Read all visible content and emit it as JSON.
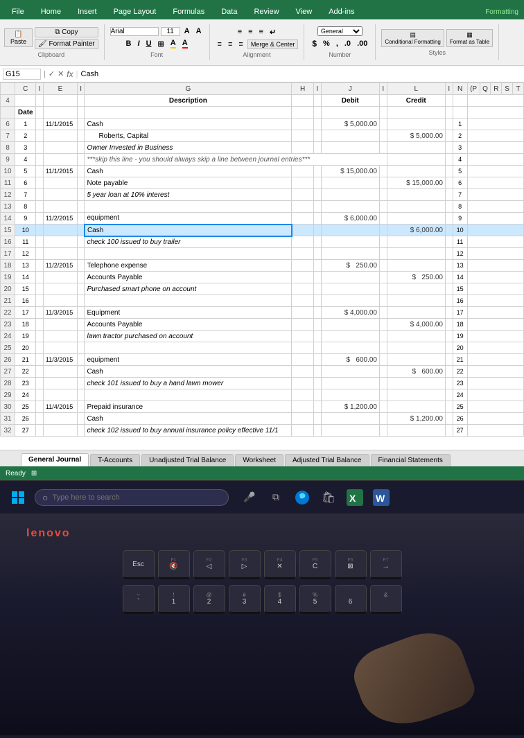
{
  "ribbon": {
    "tabs": [
      "File",
      "Home",
      "Insert",
      "Page Layout",
      "Formulas",
      "Data",
      "Review",
      "View",
      "Add-ins"
    ],
    "active_tab": "Home",
    "clipboard_group": "Clipboard",
    "paste_label": "Paste",
    "copy_label": "Copy",
    "format_painter_label": "Format Painter",
    "font_group": "Font",
    "font_name": "Arial",
    "font_size": "11",
    "bold": "B",
    "italic": "I",
    "underline": "U",
    "alignment_group": "Alignment",
    "merge_center_label": "Merge & Center",
    "number_group": "Number",
    "dollar_label": "$",
    "percent_label": "%",
    "number_format_label": "General",
    "conditional_label": "Conditional Formatting",
    "format_as_table": "Format as Table",
    "formatting_label": "Formatting"
  },
  "formula_bar": {
    "cell_ref": "G15",
    "formula_content": "Cash",
    "fx": "fx"
  },
  "col_headers": [
    "C",
    "I",
    "E",
    "I",
    "G",
    "H",
    "I",
    "J",
    "I",
    "L",
    "I",
    "N",
    "(P",
    "Q",
    "R",
    "S",
    "T"
  ],
  "header_row": {
    "row": "4",
    "date": "Date",
    "description": "Description",
    "debit": "Debit",
    "credit": "Credit"
  },
  "rows": [
    {
      "row": "4",
      "num": "",
      "date": "Date",
      "desc": "Description",
      "debit": "Debit",
      "credit": "Credit",
      "is_header": true
    },
    {
      "row": "6",
      "num": "1",
      "date": "11/1/2015",
      "desc": "Cash",
      "debit": "$ 5,000.00",
      "credit": "",
      "right_num": "1"
    },
    {
      "row": "7",
      "num": "2",
      "date": "",
      "desc": "Roberts, Capital",
      "debit": "",
      "credit": "$ 5,000.00",
      "right_num": "2",
      "indent": true
    },
    {
      "row": "8",
      "num": "3",
      "date": "",
      "desc": "Owner Invested in Business",
      "debit": "",
      "credit": "",
      "right_num": "3",
      "italic": true
    },
    {
      "row": "9",
      "num": "4",
      "date": "",
      "desc": "***skip this line - you should always skip a line between journal entries***",
      "debit": "",
      "credit": "",
      "right_num": "4",
      "note": true
    },
    {
      "row": "10",
      "num": "5",
      "date": "11/1/2015",
      "desc": "Cash",
      "debit": "$ 15,000.00",
      "credit": "",
      "right_num": "5"
    },
    {
      "row": "11",
      "num": "6",
      "date": "",
      "desc": "Note payable",
      "debit": "",
      "credit": "$ 15,000.00",
      "right_num": "6"
    },
    {
      "row": "12",
      "num": "7",
      "date": "",
      "desc": "5 year loan at 10% interest",
      "debit": "",
      "credit": "",
      "right_num": "7",
      "italic": true
    },
    {
      "row": "13",
      "num": "8",
      "date": "",
      "desc": "",
      "debit": "",
      "credit": "",
      "right_num": "8"
    },
    {
      "row": "14",
      "num": "9",
      "date": "11/2/2015",
      "desc": "equipment",
      "debit": "$ 6,000.00",
      "credit": "",
      "right_num": "9"
    },
    {
      "row": "15",
      "num": "10",
      "date": "",
      "desc": "Cash",
      "debit": "",
      "credit": "$ 6,000.00",
      "right_num": "10",
      "selected": true
    },
    {
      "row": "16",
      "num": "11",
      "date": "",
      "desc": "check 100 issued to buy trailer",
      "debit": "",
      "credit": "",
      "right_num": "11",
      "italic": true
    },
    {
      "row": "17",
      "num": "12",
      "date": "",
      "desc": "",
      "debit": "",
      "credit": "",
      "right_num": "12"
    },
    {
      "row": "18",
      "num": "13",
      "date": "11/2/2015",
      "desc": "Telephone expense",
      "debit": "$ 250.00",
      "credit": "",
      "right_num": "13"
    },
    {
      "row": "19",
      "num": "14",
      "date": "",
      "desc": "Accounts Payable",
      "debit": "",
      "credit": "$ 250.00",
      "right_num": "14"
    },
    {
      "row": "20",
      "num": "15",
      "date": "",
      "desc": "Purchased smart phone on account",
      "debit": "",
      "credit": "",
      "right_num": "15",
      "italic": true
    },
    {
      "row": "21",
      "num": "16",
      "date": "",
      "desc": "",
      "debit": "",
      "credit": "",
      "right_num": "16"
    },
    {
      "row": "22",
      "num": "17",
      "date": "11/3/2015",
      "desc": "Equipment",
      "debit": "$ 4,000.00",
      "credit": "",
      "right_num": "17"
    },
    {
      "row": "23",
      "num": "18",
      "date": "",
      "desc": "Accounts Payable",
      "debit": "",
      "credit": "$ 4,000.00",
      "right_num": "18"
    },
    {
      "row": "24",
      "num": "19",
      "date": "",
      "desc": "lawn tractor purchased on account",
      "debit": "",
      "credit": "",
      "right_num": "19",
      "italic": true
    },
    {
      "row": "25",
      "num": "20",
      "date": "",
      "desc": "",
      "debit": "",
      "credit": "",
      "right_num": "20"
    },
    {
      "row": "26",
      "num": "21",
      "date": "11/3/2015",
      "desc": "equipment",
      "debit": "$ 600.00",
      "credit": "",
      "right_num": "21"
    },
    {
      "row": "27",
      "num": "22",
      "date": "",
      "desc": "Cash",
      "debit": "",
      "credit": "$ 600.00",
      "right_num": "22"
    },
    {
      "row": "28",
      "num": "23",
      "date": "",
      "desc": "check 101 issued to buy a hand lawn mower",
      "debit": "",
      "credit": "",
      "right_num": "23",
      "italic": true
    },
    {
      "row": "29",
      "num": "24",
      "date": "",
      "desc": "",
      "debit": "",
      "credit": "",
      "right_num": "24"
    },
    {
      "row": "30",
      "num": "25",
      "date": "11/4/2015",
      "desc": "Prepaid insurance",
      "debit": "$ 1,200.00",
      "credit": "",
      "right_num": "25"
    },
    {
      "row": "31",
      "num": "26",
      "date": "",
      "desc": "Cash",
      "debit": "",
      "credit": "$ 1,200.00",
      "right_num": "26"
    },
    {
      "row": "32",
      "num": "27",
      "date": "",
      "desc": "check 102 issued to buy annual insurance policy effective 11/1",
      "debit": "",
      "credit": "",
      "right_num": "27",
      "italic": true
    }
  ],
  "sheet_tabs": [
    "General Journal",
    "T-Accounts",
    "Unadjusted Trial Balance",
    "Worksheet",
    "Adjusted Trial Balance",
    "Financial Statements"
  ],
  "active_sheet": "General Journal",
  "status_bar": {
    "ready": "Ready"
  },
  "taskbar": {
    "search_placeholder": "Type here to search",
    "windows_icon": "⊞",
    "search_icon": "○"
  },
  "keyboard": {
    "row1": [
      {
        "main": "Esc"
      },
      {
        "top": "F1",
        "main": "🔇"
      },
      {
        "top": "F2",
        "main": "◁"
      },
      {
        "top": "F3",
        "main": "▷"
      },
      {
        "top": "F4",
        "main": "✕"
      },
      {
        "top": "F5",
        "main": "C"
      },
      {
        "top": "F6",
        "main": "⊠"
      },
      {
        "top": "F7",
        "main": "→"
      }
    ],
    "row2": [
      {
        "top": "~",
        "main": "`"
      },
      {
        "top": "!",
        "main": "1"
      },
      {
        "top": "@",
        "main": "2"
      },
      {
        "top": "#",
        "main": "3"
      },
      {
        "top": "$",
        "main": "4"
      },
      {
        "top": "%",
        "main": "5"
      },
      {
        "top": "",
        "main": "6"
      },
      {
        "top": "&",
        "main": ""
      }
    ],
    "lenovo_brand": "lenovo"
  }
}
